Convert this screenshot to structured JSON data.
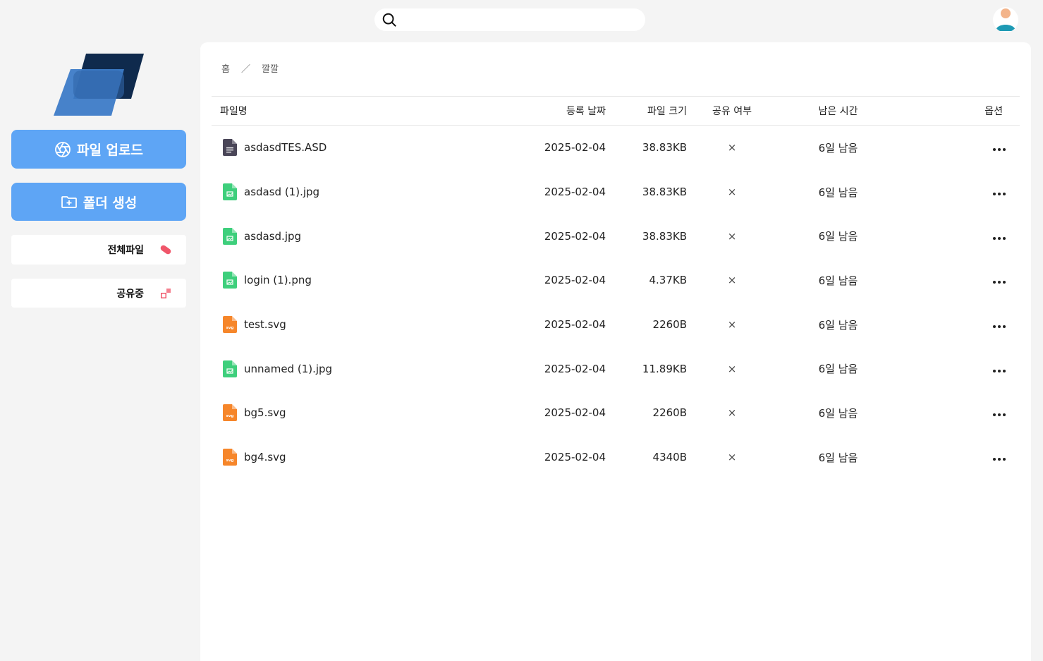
{
  "search": {
    "value": "",
    "placeholder": ""
  },
  "sidebar": {
    "upload_label": "파일 업로드",
    "folder_label": "폴더 생성",
    "items": [
      {
        "label": "전체파일",
        "icon": "pill-icon",
        "color": "#f0566a"
      },
      {
        "label": "공유중",
        "icon": "share-icon",
        "color": "#f0566a"
      }
    ]
  },
  "breadcrumb": {
    "home": "홈",
    "separator": "／",
    "current": "깔깔"
  },
  "table": {
    "headers": {
      "name": "파일명",
      "date": "등록 날짜",
      "size": "파일 크기",
      "share": "공유 여부",
      "remaining": "남은 시간",
      "options": "옵션"
    },
    "rows": [
      {
        "name": "asdasdTES.ASD",
        "type": "document",
        "date": "2025-02-04",
        "size": "38.83KB",
        "shared": "×",
        "remaining": "6일 남음"
      },
      {
        "name": "asdasd (1).jpg",
        "type": "image",
        "date": "2025-02-04",
        "size": "38.83KB",
        "shared": "×",
        "remaining": "6일 남음"
      },
      {
        "name": "asdasd.jpg",
        "type": "image",
        "date": "2025-02-04",
        "size": "38.83KB",
        "shared": "×",
        "remaining": "6일 남음"
      },
      {
        "name": "login (1).png",
        "type": "image",
        "date": "2025-02-04",
        "size": "4.37KB",
        "shared": "×",
        "remaining": "6일 남음"
      },
      {
        "name": "test.svg",
        "type": "svg",
        "date": "2025-02-04",
        "size": "2260B",
        "shared": "×",
        "remaining": "6일 남음"
      },
      {
        "name": "unnamed (1).jpg",
        "type": "image",
        "date": "2025-02-04",
        "size": "11.89KB",
        "shared": "×",
        "remaining": "6일 남음"
      },
      {
        "name": "bg5.svg",
        "type": "svg",
        "date": "2025-02-04",
        "size": "2260B",
        "shared": "×",
        "remaining": "6일 남음"
      },
      {
        "name": "bg4.svg",
        "type": "svg",
        "date": "2025-02-04",
        "size": "4340B",
        "shared": "×",
        "remaining": "6일 남음"
      }
    ]
  },
  "icon_text": {
    "svg": "svg"
  },
  "colors": {
    "primary": "#5ea5f5",
    "logo_dark": "#0f2a4d",
    "logo_light": "#3d7bc7",
    "image_file": "#3ecf7c",
    "svg_file": "#f6862a",
    "doc_file": "#4a4658",
    "accent": "#f0566a"
  }
}
